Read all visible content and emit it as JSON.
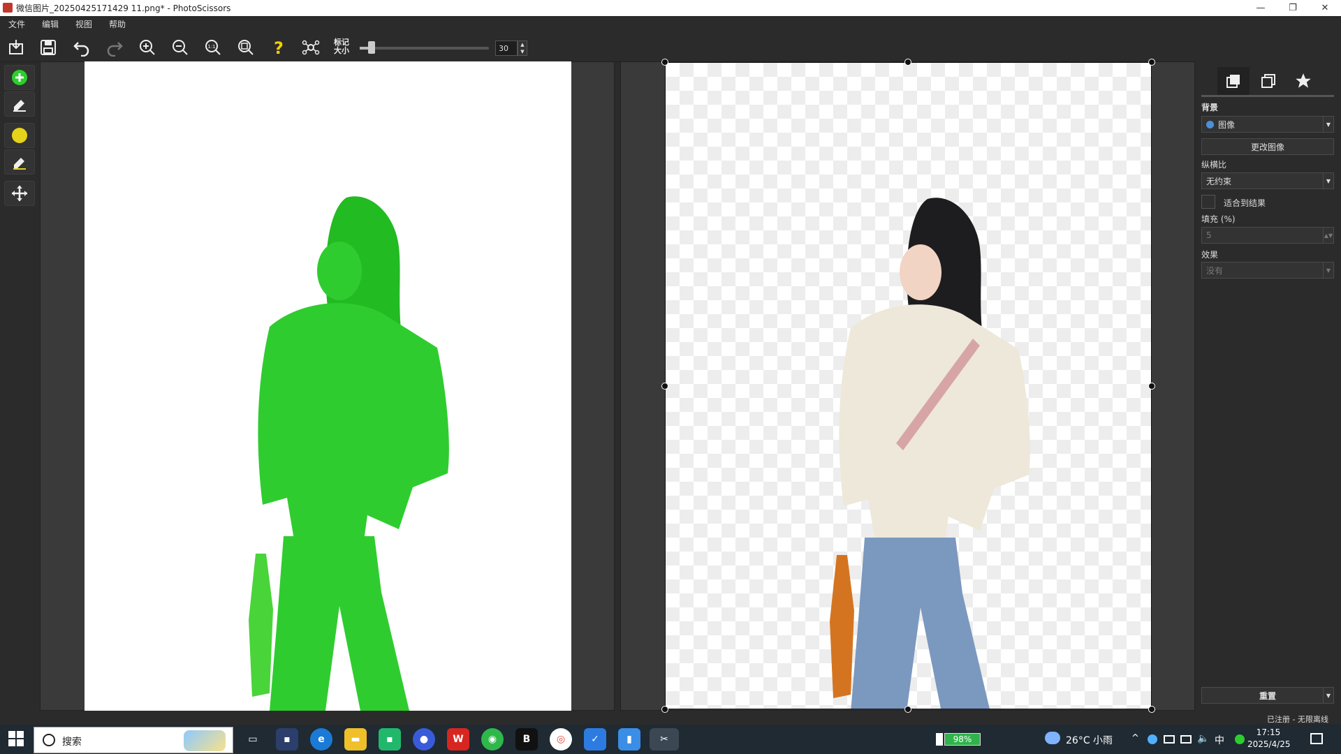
{
  "window": {
    "title": "微信图片_20250425171429 11.png* - PhotoScissors",
    "controls": [
      "—",
      "❐",
      "✕"
    ]
  },
  "menu": [
    "文件",
    "编辑",
    "视图",
    "帮助"
  ],
  "toolbar": {
    "buttons": [
      "import-icon",
      "save-icon",
      "undo-icon",
      "redo-icon",
      "zoom-in-icon",
      "zoom-out-icon",
      "actual-size-icon",
      "fit-icon",
      "help-icon",
      "marker-network-icon"
    ],
    "marker_label_line1": "标记",
    "marker_label_line2": "大小",
    "marker_size": "30"
  },
  "left_tools": [
    "add-foreground-marker-icon",
    "eraser-icon",
    "background-marker-icon",
    "background-eraser-icon",
    "move-icon"
  ],
  "right_panel": {
    "tabs": [
      "layers-icon",
      "copy-icon",
      "star-icon"
    ],
    "background_label": "背景",
    "background_value": "图像",
    "change_image_button": "更改图像",
    "aspect_label": "纵横比",
    "aspect_value": "无约束",
    "fit_checkbox_label": "适合到结果",
    "padding_label": "填充 (%)",
    "padding_value": "5",
    "effect_label": "效果",
    "effect_value": "没有",
    "reset_button": "重置"
  },
  "status_text": "已注册 - 无限离线",
  "taskbar": {
    "search_placeholder": "搜索",
    "battery": "98%",
    "weather": "26°C 小雨",
    "lang": "中",
    "time": "17:15",
    "date": "2025/4/25"
  },
  "colors": {
    "accent_green": "#2fcc2f",
    "background_dark": "#2b2b2b",
    "marker_yellow": "#e6d21a"
  }
}
